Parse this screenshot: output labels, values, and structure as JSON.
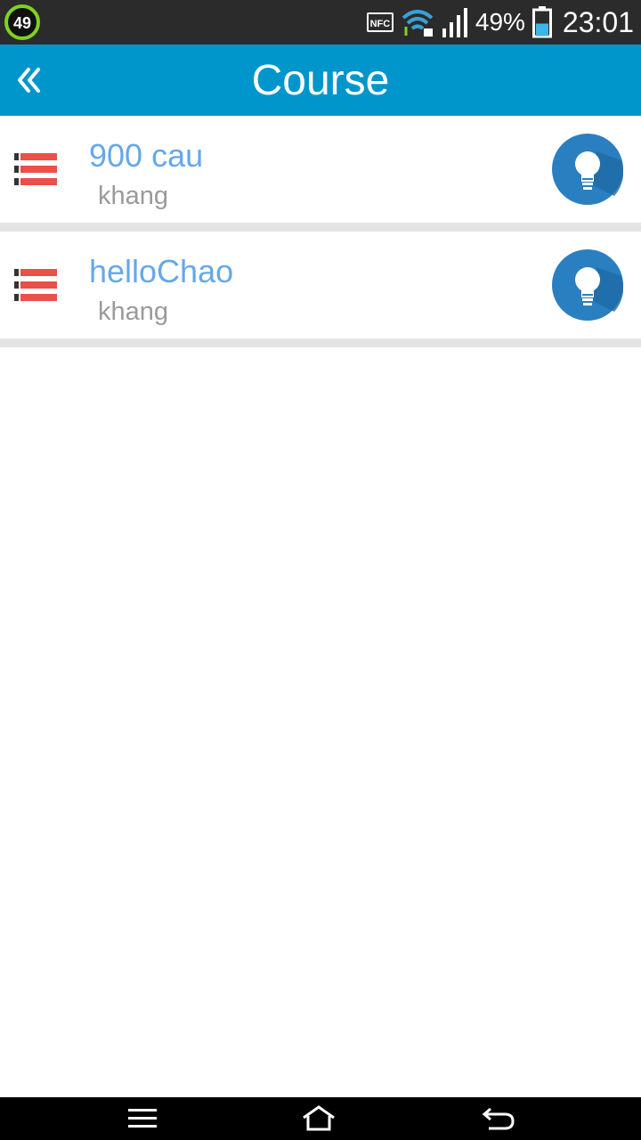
{
  "status_bar": {
    "notification_badge": "49",
    "nfc_label": "NFC",
    "battery_percent": "49%",
    "battery_level": 0.49,
    "time": "23:01",
    "icons": [
      "nfc-icon",
      "wifi-icon",
      "signal-icon",
      "battery-icon"
    ]
  },
  "app_bar": {
    "title": "Course",
    "back_icon": "double-chevron-left-icon",
    "background": "#0096cc"
  },
  "courses": [
    {
      "title": "900 cau",
      "author": "khang"
    },
    {
      "title": "helloChao",
      "author": "khang"
    }
  ],
  "colors": {
    "title_text": "#66a8e8",
    "subtitle_text": "#9a9a9a",
    "list_icon": "#e8504a",
    "bulb_circle": "#2a7fc0"
  },
  "nav_bar": {
    "buttons": [
      "menu-icon",
      "home-icon",
      "back-icon"
    ]
  }
}
